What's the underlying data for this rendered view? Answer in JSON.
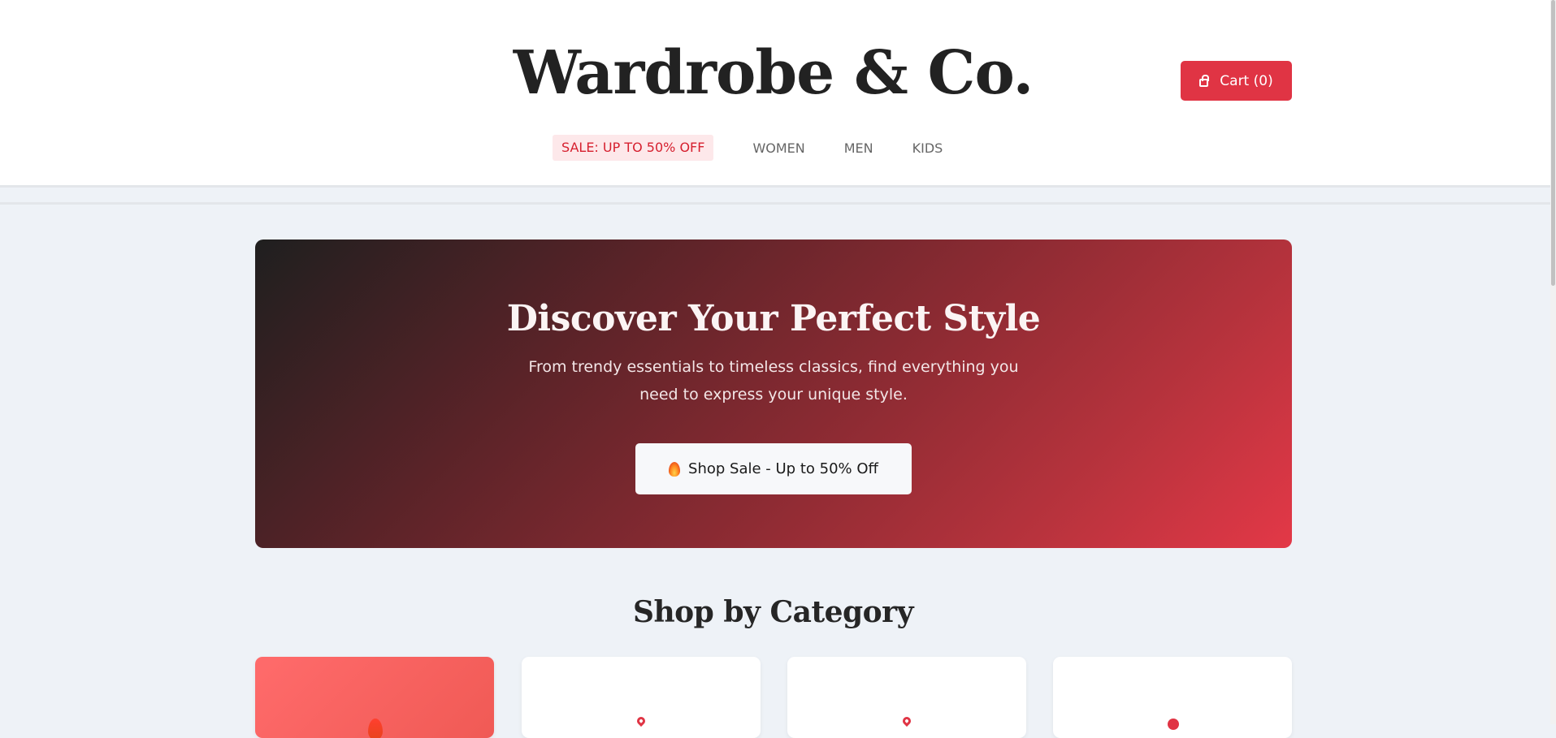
{
  "header": {
    "brand": "Wardrobe & Co.",
    "cart_label": "Cart (0)",
    "nav": {
      "sale": "SALE: UP TO 50% OFF",
      "women": "WOMEN",
      "men": "MEN",
      "kids": "KIDS"
    }
  },
  "hero": {
    "title": "Discover Your Perfect Style",
    "subtitle": "From trendy essentials to timeless classics, find everything you need to express your unique style.",
    "cta_label": "Shop Sale - Up to 50% Off",
    "cta_icon": "flame-icon"
  },
  "categories": {
    "title": "Shop by Category",
    "cards": [
      {
        "icon": "flame-icon"
      },
      {
        "icon": "pin-icon"
      },
      {
        "icon": "pin-icon"
      },
      {
        "icon": "dot-icon"
      }
    ]
  },
  "colors": {
    "brand_red": "#e03444",
    "sale_text": "#d6202f",
    "sale_bg": "#fde8ea",
    "page_bg": "#eef2f7",
    "text_dark": "#222222"
  }
}
